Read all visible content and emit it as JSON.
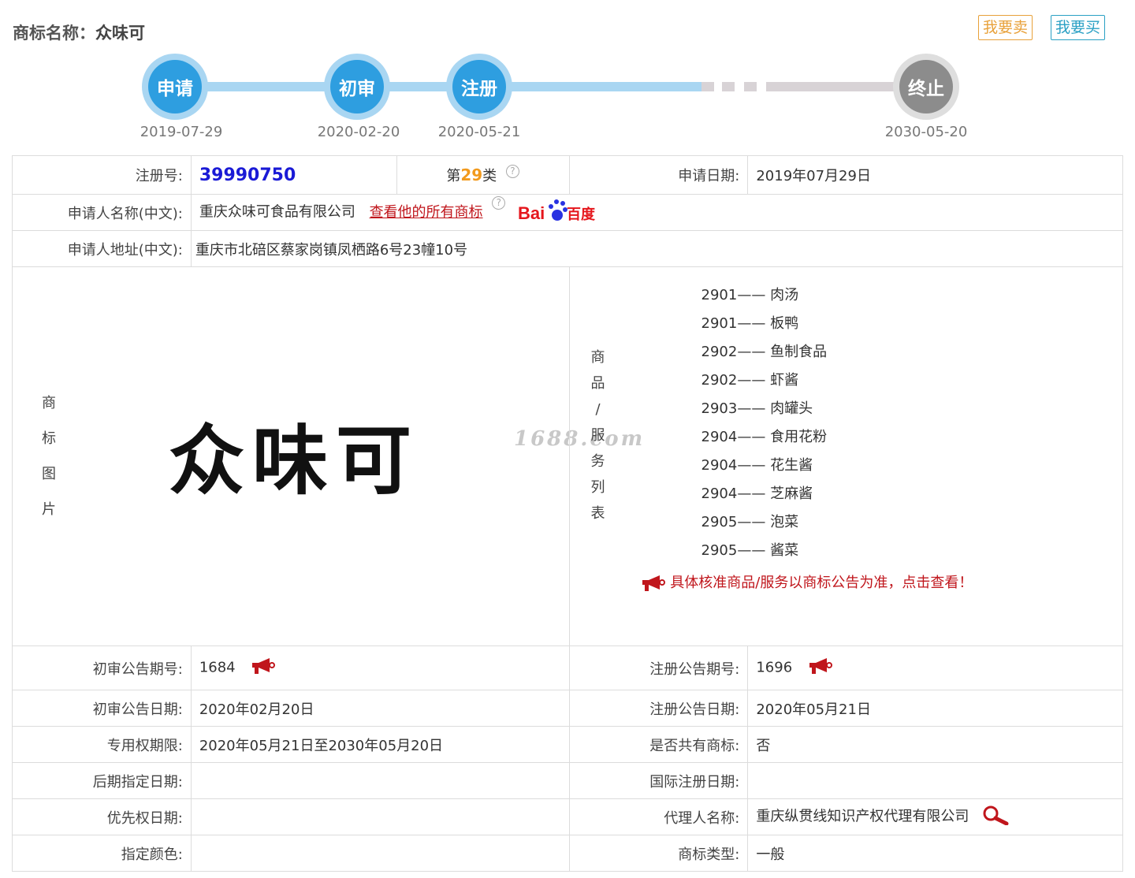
{
  "header": {
    "title_label": "商标名称：",
    "title_value": "众味可",
    "sell_button": "我要卖",
    "buy_button": "我要买"
  },
  "timeline": [
    {
      "label": "申请",
      "date": "2019-07-29",
      "status": "done",
      "color": "#2e9ee0"
    },
    {
      "label": "初审",
      "date": "2020-02-20",
      "status": "done",
      "color": "#2e9ee0"
    },
    {
      "label": "注册",
      "date": "2020-05-21",
      "status": "done",
      "color": "#2e9ee0"
    },
    {
      "label": "终止",
      "date": "2030-05-20",
      "status": "pending",
      "color": "#8c8c8c"
    }
  ],
  "info": {
    "reg_no_label": "注册号:",
    "reg_no": "39990750",
    "class_prefix": "第",
    "class_num": "29",
    "class_suffix": "类",
    "apply_date_label": "申请日期:",
    "apply_date": "2019年07月29日",
    "applicant_label": "申请人名称(中文):",
    "applicant": "重庆众味可食品有限公司",
    "all_marks_link": "查看他的所有商标",
    "baidu_logo_text": "Bai百度",
    "address_label": "申请人地址(中文):",
    "address": "重庆市北碚区蔡家岗镇凤栖路6号23幢10号",
    "mark_image_label": [
      "商",
      "标",
      "图",
      "片"
    ],
    "mark_image_text": "众味可",
    "goods_label": [
      "商",
      "品",
      "/",
      "服",
      "务",
      "列",
      "表"
    ],
    "goods": [
      {
        "code": "2901",
        "name": "肉汤"
      },
      {
        "code": "2901",
        "name": "板鸭"
      },
      {
        "code": "2902",
        "name": "鱼制食品"
      },
      {
        "code": "2902",
        "name": "虾酱"
      },
      {
        "code": "2903",
        "name": "肉罐头"
      },
      {
        "code": "2904",
        "name": "食用花粉"
      },
      {
        "code": "2904",
        "name": "花生酱"
      },
      {
        "code": "2904",
        "name": "芝麻酱"
      },
      {
        "code": "2905",
        "name": "泡菜"
      },
      {
        "code": "2905",
        "name": "酱菜"
      }
    ],
    "goods_separator": "——",
    "goods_notice": "具体核准商品/服务以商标公告为准，点击查看！",
    "watermark": "1688.com",
    "prelim_issue_label": "初审公告期号:",
    "prelim_issue": "1684",
    "reg_issue_label": "注册公告期号:",
    "reg_issue": "1696",
    "prelim_date_label": "初审公告日期:",
    "prelim_date": "2020年02月20日",
    "reg_date_label": "注册公告日期:",
    "reg_date": "2020年05月21日",
    "exclusive_label": "专用权期限:",
    "exclusive": "2020年05月21日至2030年05月20日",
    "shared_label": "是否共有商标:",
    "shared": "否",
    "later_label": "后期指定日期:",
    "later": "",
    "intl_label": "国际注册日期:",
    "intl": "",
    "priority_label": "优先权日期:",
    "priority": "",
    "agent_label": "代理人名称:",
    "agent": "重庆纵贯线知识产权代理有限公司",
    "color_label": "指定颜色:",
    "color": "",
    "type_label": "商标类型:",
    "type": "一般"
  }
}
